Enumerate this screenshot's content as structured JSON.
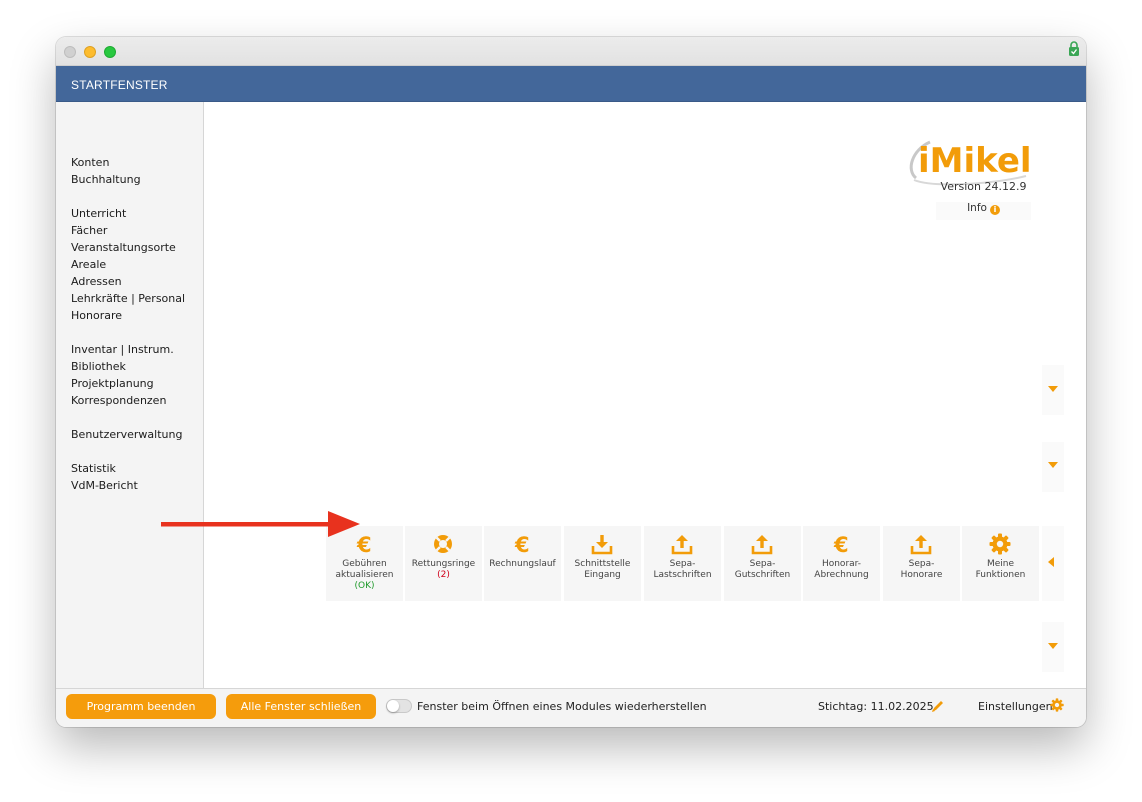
{
  "window": {
    "header_title": "STARTFENSTER"
  },
  "sidebar": {
    "groups": [
      [
        "Konten",
        "Buchhaltung"
      ],
      [
        "Unterricht",
        "Fächer",
        "Veranstaltungsorte",
        "Areale",
        "Adressen",
        "Lehrkräfte | Personal",
        "Honorare"
      ],
      [
        "Inventar | Instrum.",
        "Bibliothek",
        "Projektplanung",
        "Korrespondenzen"
      ],
      [
        "Benutzerverwaltung"
      ],
      [
        "Statistik",
        "VdM-Bericht"
      ]
    ]
  },
  "logo": {
    "brand": "iMikel",
    "version": "Version 24.12.9",
    "info_label": "Info"
  },
  "tiles": [
    {
      "icon": "euro-icon",
      "label1": "Gebühren",
      "label2": "aktualisieren",
      "sub": "(OK)"
    },
    {
      "icon": "lifebuoy-icon",
      "label1": "Rettungsringe",
      "label2": "",
      "sub": "(2)"
    },
    {
      "icon": "euro-icon",
      "label1": "Rechnungslauf",
      "label2": "",
      "sub": ""
    },
    {
      "icon": "download-icon",
      "label1": "Schnittstelle",
      "label2": "Eingang",
      "sub": ""
    },
    {
      "icon": "upload-icon",
      "label1": "Sepa-",
      "label2": "Lastschriften",
      "sub": ""
    },
    {
      "icon": "upload-icon",
      "label1": "Sepa-",
      "label2": "Gutschriften",
      "sub": ""
    },
    {
      "icon": "euro-icon",
      "label1": "Honorar-",
      "label2": "Abrechnung",
      "sub": ""
    },
    {
      "icon": "upload-icon",
      "label1": "Sepa-",
      "label2": "Honorare",
      "sub": ""
    },
    {
      "icon": "gear-icon",
      "label1": "Meine",
      "label2": "Funktionen",
      "sub": ""
    }
  ],
  "footer": {
    "quit_label": "Programm beenden",
    "close_all_label": "Alle Fenster schließen",
    "toggle_label": "Fenster beim Öffnen eines Modules wiederherstellen",
    "toggle_on": false,
    "stichtag": "Stichtag: 11.02.2025",
    "settings_label": "Einstellungen"
  },
  "colors": {
    "accent": "#f59c0c",
    "header": "#43679a",
    "ok": "#1f9a2b",
    "warn": "#d0021b",
    "arrow": "#e8321e"
  }
}
